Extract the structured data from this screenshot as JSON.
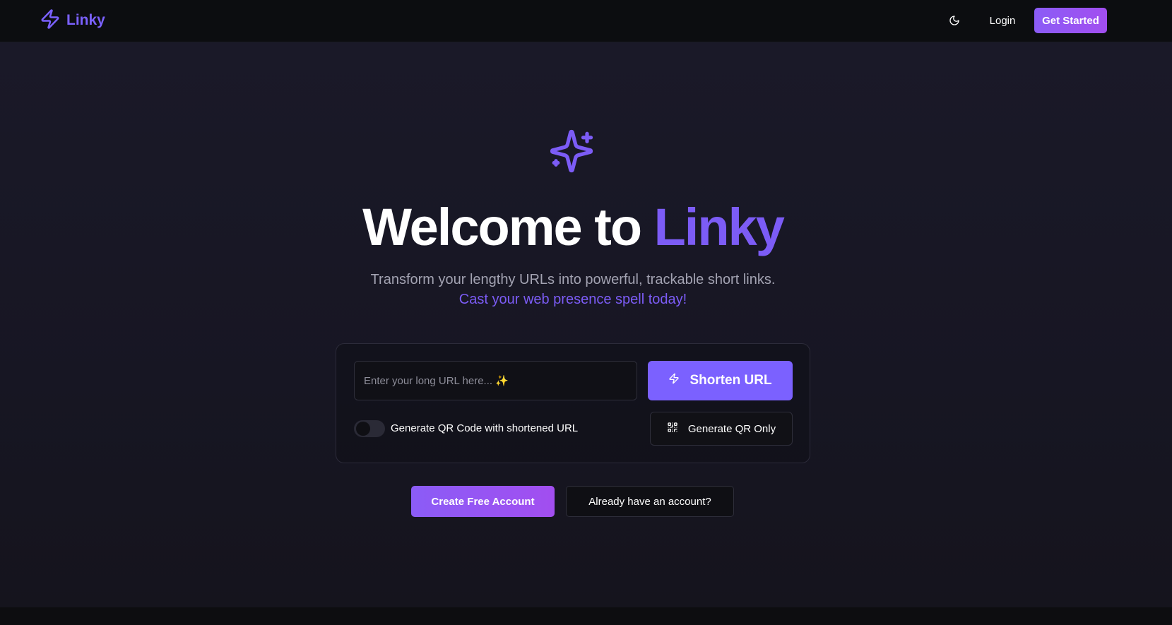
{
  "navbar": {
    "brand": "Linky",
    "brand_icon": "lightning-bolt-icon",
    "theme_icon": "moon-icon",
    "login_label": "Login",
    "get_started_label": "Get Started"
  },
  "hero": {
    "icon": "sparkles-icon",
    "title_prefix": "Welcome to ",
    "title_accent": "Linky",
    "subtitle": "Transform your lengthy URLs into powerful, trackable short links.",
    "tagline": "Cast your web presence spell today!"
  },
  "shortener": {
    "input_placeholder": "Enter your long URL here... ✨",
    "input_value": "",
    "shorten_label": "Shorten URL",
    "shorten_icon": "lightning-bolt-icon",
    "qr_toggle_on": false,
    "qr_toggle_label": "Generate QR Code with shortened URL",
    "qr_only_label": "Generate QR Only",
    "qr_only_icon": "qr-code-icon"
  },
  "cta": {
    "create_label": "Create Free Account",
    "account_label": "Already have an account?"
  },
  "colors": {
    "accent": "#7b61ff",
    "gradient_start": "#8b5cf6",
    "gradient_end": "#a24ef0",
    "background": "#17161f",
    "navbar_bg": "#0c0d10"
  }
}
